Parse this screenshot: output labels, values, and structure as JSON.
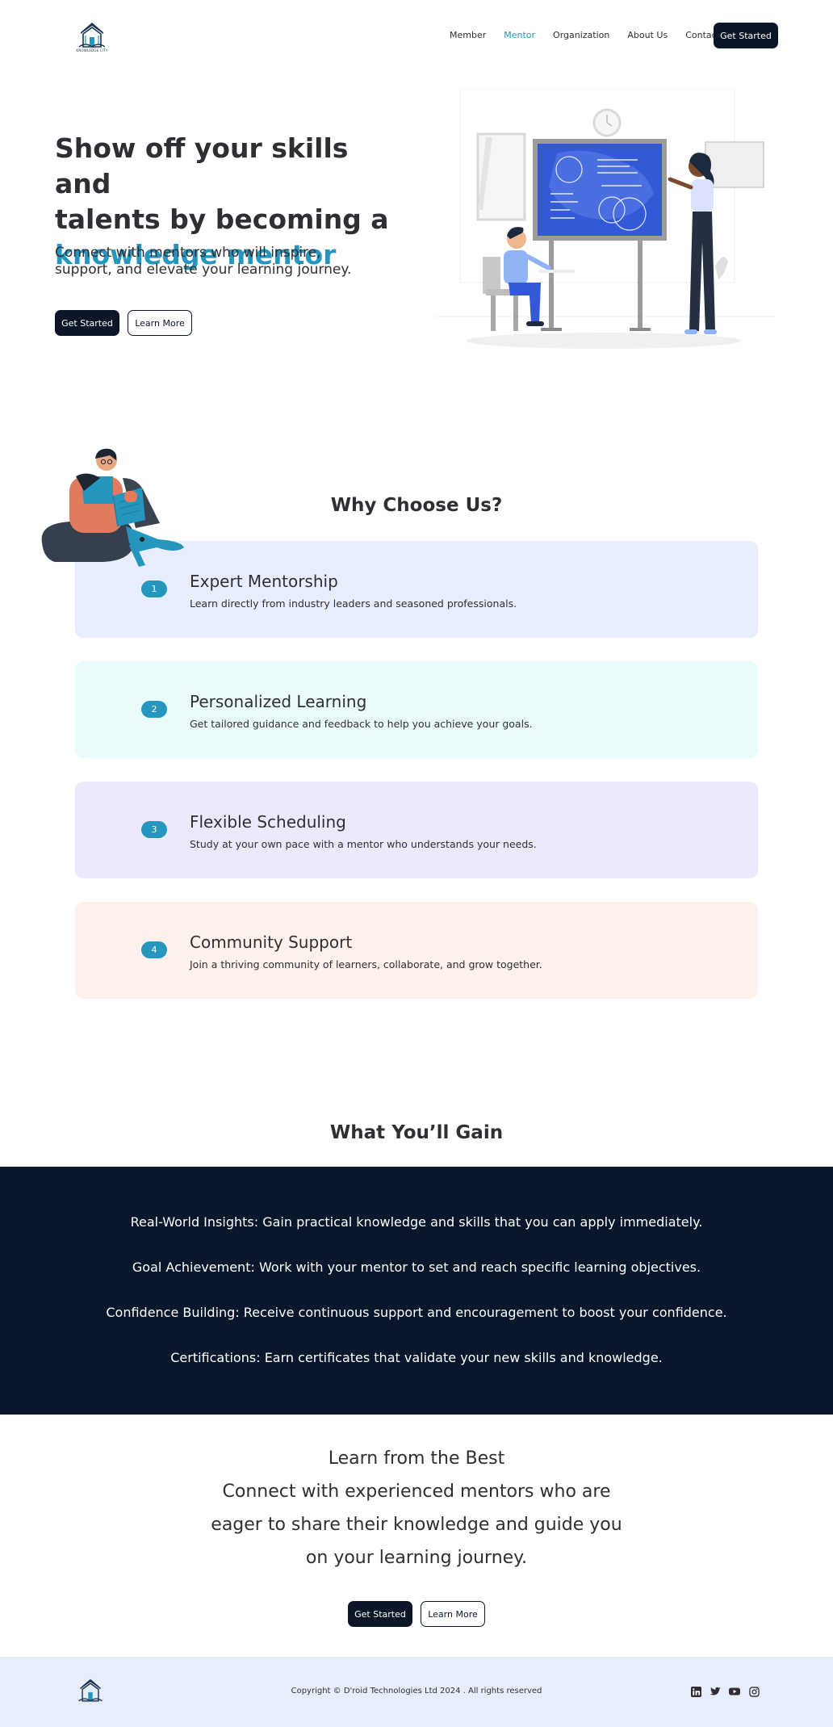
{
  "nav": {
    "logo_text": "KNOWLEDGE CITY",
    "links": [
      {
        "label": "Member"
      },
      {
        "label": "Mentor"
      },
      {
        "label": "Organization"
      },
      {
        "label": "About Us"
      },
      {
        "label": "Contact Us"
      }
    ],
    "active_link": "Mentor",
    "cta": "Get Started"
  },
  "hero": {
    "title_line1": "Show off your skills and",
    "title_line2": "talents by becoming a",
    "title_accent": "knowledge mentor",
    "subtitle": "Connect with mentors who will inspire, support, and elevate your learning journey.",
    "primary_button": "Get Started",
    "secondary_button": "Learn More"
  },
  "why": {
    "title": "Why Choose Us?",
    "cards": [
      {
        "number": "1",
        "title": "Expert Mentorship",
        "description": " Learn directly from industry leaders and seasoned professionals.",
        "bg": "#e8edfd"
      },
      {
        "number": "2",
        "title": "Personalized Learning",
        "description": "Get tailored guidance and feedback to help you achieve your goals.",
        "bg": "#ebfcfd"
      },
      {
        "number": "3",
        "title": "Flexible Scheduling",
        "description": "Study at your own pace with a mentor who understands your needs.",
        "bg": "#ebe9fb"
      },
      {
        "number": "4",
        "title": "Community Support",
        "description": "Join a thriving community of learners, collaborate, and grow together.",
        "bg": "#fef0ea"
      }
    ]
  },
  "gain": {
    "title": "What You’ll Gain",
    "items": [
      {
        "label": "Real-World Insights:",
        "text": "Gain practical knowledge and skills that you can apply immediately."
      },
      {
        "label": "Goal Achievement:",
        "text": "Work with your mentor to set and reach specific learning objectives."
      },
      {
        "label": "Confidence Building:",
        "text": "Receive continuous support and encouragement to boost your confidence."
      },
      {
        "label": "Certifications:",
        "text": " Earn certificates that validate your new skills and knowledge."
      }
    ]
  },
  "learn": {
    "heading": "Learn from the Best",
    "line1": "Connect with experienced mentors who are",
    "line2": "eager to share their knowledge and guide you",
    "line3": "on your learning journey.",
    "primary_button": "Get Started",
    "secondary_button": "Learn More"
  },
  "footer": {
    "copyright": "Copyright © D'roid Technologies Ltd 2024 . All rights reserved",
    "socials": [
      "linkedin-icon",
      "twitter-icon",
      "youtube-icon",
      "instagram-icon"
    ]
  },
  "colors": {
    "accent": "#2596be",
    "dark": "#0b1627",
    "band": "#08172b",
    "footer_bg": "#e8edfb"
  }
}
